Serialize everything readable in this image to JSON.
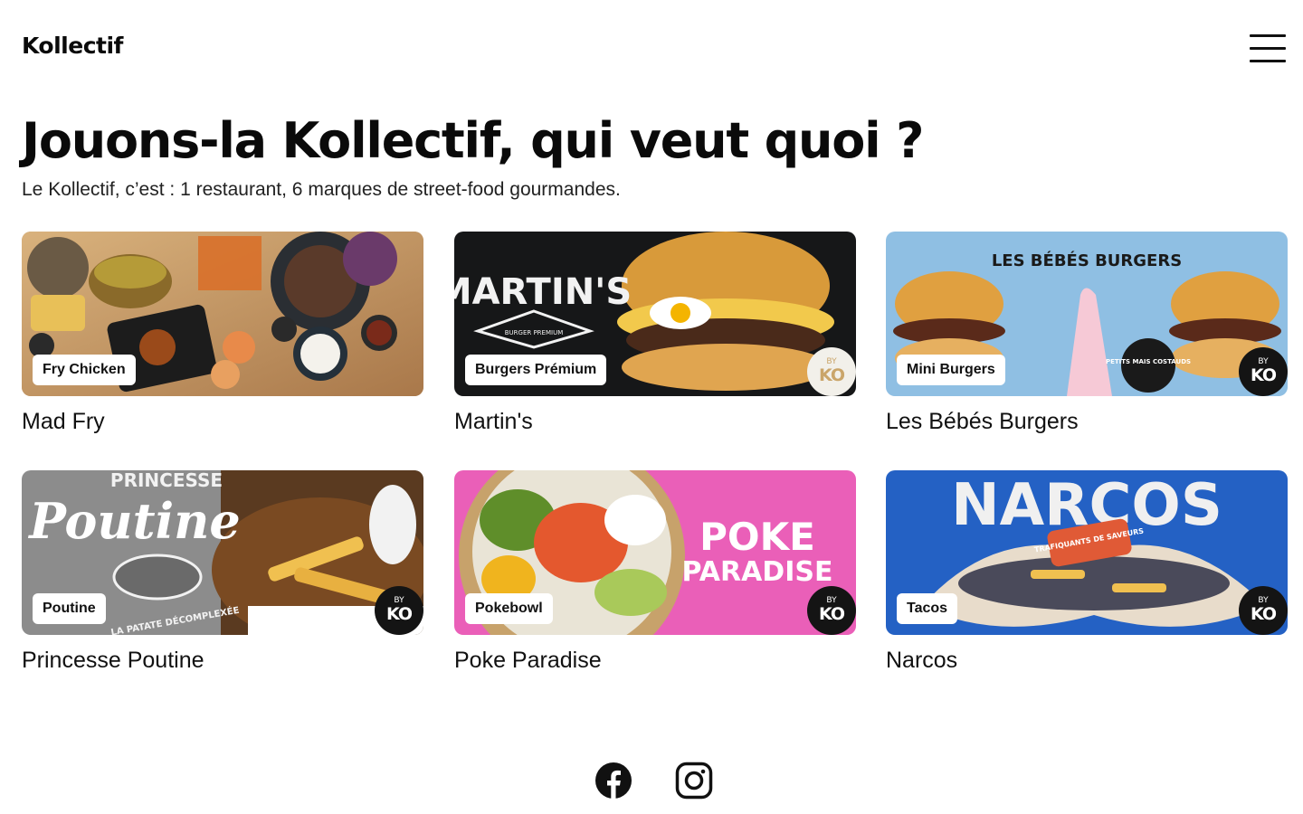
{
  "header": {
    "logo": "Kollectif",
    "menu_icon": "hamburger-menu-icon"
  },
  "hero": {
    "title": "Jouons-la Kollectif, qui veut quoi ?",
    "subtitle": "Le Kollectif, c’est : 1 restaurant, 6 marques de street-food gourmandes."
  },
  "cards": [
    {
      "name": "Mad Fry",
      "category": "Fry Chicken",
      "badge": ""
    },
    {
      "name": "Martin's",
      "category": "Burgers Prémium",
      "badge": "BY KO",
      "badge_by": "BY",
      "badge_ko": "KO",
      "image_text": "MARTIN'S",
      "image_subtext": "BURGER PREMIUM"
    },
    {
      "name": "Les Bébés Burgers",
      "category": "Mini Burgers",
      "badge": "BY KO",
      "badge_by": "BY",
      "badge_ko": "KO",
      "image_text": "LES BÉBÉS BURGERS",
      "image_subtext": "PETITS MAIS COSTAUDS"
    },
    {
      "name": "Princesse Poutine",
      "category": "Poutine",
      "badge": "BY KO",
      "badge_by": "BY",
      "badge_ko": "KO",
      "image_text": "PRINCESSE",
      "image_text2": "Poutine",
      "image_subtext": "LA PATATE DÉCOMPLEXÉE"
    },
    {
      "name": "Poke Paradise",
      "category": "Pokebowl",
      "badge": "BY KO",
      "badge_by": "BY",
      "badge_ko": "KO",
      "image_text": "POKE",
      "image_text2": "PARADISE"
    },
    {
      "name": "Narcos",
      "category": "Tacos",
      "badge": "BY KO",
      "badge_by": "BY",
      "badge_ko": "KO",
      "image_text": "NARCOS",
      "image_subtext": "TRAFIQUANTS DE SAVEURS"
    }
  ],
  "footer": {
    "social": [
      "facebook-icon",
      "instagram-icon"
    ]
  },
  "colors": {
    "text": "#111111",
    "background": "#ffffff",
    "badge_dark": "#141414"
  }
}
